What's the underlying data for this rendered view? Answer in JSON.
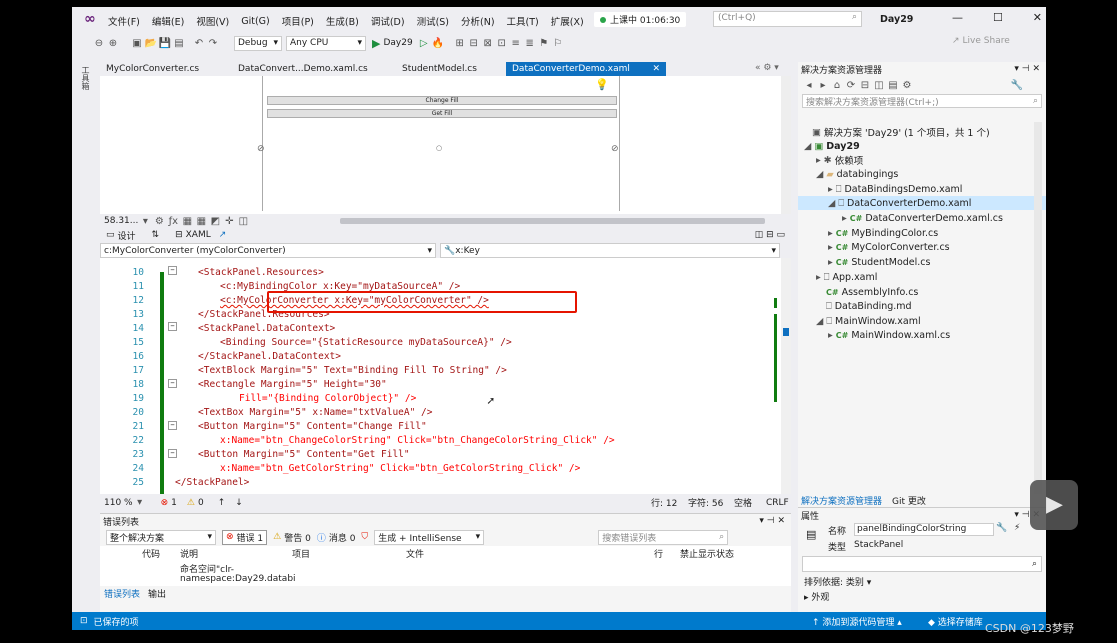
{
  "menu": [
    "文件(F)",
    "编辑(E)",
    "视图(V)",
    "Git(G)",
    "项目(P)",
    "生成(B)",
    "调试(D)",
    "测试(S)",
    "分析(N)",
    "工具(T)",
    "扩展(X)"
  ],
  "recording": "上课中 01:06:30",
  "search_placeholder": "(Ctrl+Q)",
  "solution_name": "Day29",
  "toolbar": {
    "config": "Debug",
    "platform": "Any CPU",
    "run": "Day29",
    "live_share": "Live Share"
  },
  "tabs": [
    {
      "label": "MyColorConverter.cs"
    },
    {
      "label": "DataConvert...Demo.xaml.cs"
    },
    {
      "label": "StudentModel.cs"
    },
    {
      "label": "DataConverterDemo.xaml"
    }
  ],
  "designer": {
    "buttons": [
      "Change Fill",
      "Get Fill"
    ],
    "zoom": "58.31..."
  },
  "split": {
    "design": "设计",
    "xaml": "XAML"
  },
  "navbar": {
    "left": "c:MyColorConverter (myColorConverter)",
    "right": "x:Key"
  },
  "code_lines": [
    {
      "n": "10",
      "t": "<StackPanel.Resources>"
    },
    {
      "n": "11",
      "t": "<c:MyBindingColor x:Key=\"myDataSourceA\" />"
    },
    {
      "n": "12",
      "t": "<c:MyColorConverter x:Key=\"myColorConverter\" />"
    },
    {
      "n": "13",
      "t": "</StackPanel.Resources>"
    },
    {
      "n": "14",
      "t": "<StackPanel.DataContext>"
    },
    {
      "n": "15",
      "t": "<Binding Source=\"{StaticResource myDataSourceA}\" />"
    },
    {
      "n": "16",
      "t": "</StackPanel.DataContext>"
    },
    {
      "n": "17",
      "t": "<TextBlock Margin=\"5\" Text=\"Binding Fill To String\" />"
    },
    {
      "n": "18",
      "t": "<Rectangle Margin=\"5\" Height=\"30\""
    },
    {
      "n": "19",
      "t": "Fill=\"{Binding ColorObject}\" />"
    },
    {
      "n": "20",
      "t": "<TextBox Margin=\"5\" x:Name=\"txtValueA\" />"
    },
    {
      "n": "21",
      "t": "<Button Margin=\"5\" Content=\"Change Fill\""
    },
    {
      "n": "22",
      "t": "x:Name=\"btn_ChangeColorString\" Click=\"btn_ChangeColorString_Click\" />"
    },
    {
      "n": "23",
      "t": "<Button Margin=\"5\" Content=\"Get Fill\""
    },
    {
      "n": "24",
      "t": "x:Name=\"btn_GetColorString\" Click=\"btn_GetColorString_Click\" />"
    },
    {
      "n": "25",
      "t": "</StackPanel>"
    }
  ],
  "editor_status": {
    "zoom": "110 %",
    "errors": "1",
    "warnings": "0",
    "line": "行: 12",
    "col": "字符: 56",
    "space": "空格",
    "eol": "CRLF"
  },
  "error_list": {
    "title": "错误列表",
    "scope": "整个解决方案",
    "errors": "错误 1",
    "warnings": "警告 0",
    "messages": "消息 0",
    "build": "生成 + IntelliSense",
    "search": "搜索错误列表",
    "cols": [
      "代码",
      "说明",
      "项目",
      "文件",
      "行",
      "禁止显示状态"
    ],
    "desc1": "命名空间\"clr-",
    "desc2": "namespace:Day29.databi",
    "tab_err": "错误列表",
    "tab_out": "输出"
  },
  "solution_explorer": {
    "title": "解决方案资源管理器",
    "search": "搜索解决方案资源管理器(Ctrl+;)",
    "root": "解决方案 'Day29' (1 个项目，共 1 个)",
    "items": [
      {
        "label": "Day29",
        "bold": true
      },
      {
        "label": "依赖项"
      },
      {
        "label": "databingings"
      },
      {
        "label": "DataBindingsDemo.xaml"
      },
      {
        "label": "DataConverterDemo.xaml"
      },
      {
        "label": "DataConverterDemo.xaml.cs"
      },
      {
        "label": "MyBindingColor.cs"
      },
      {
        "label": "MyColorConverter.cs"
      },
      {
        "label": "StudentModel.cs"
      },
      {
        "label": "App.xaml"
      },
      {
        "label": "AssemblyInfo.cs"
      },
      {
        "label": "DataBinding.md"
      },
      {
        "label": "MainWindow.xaml"
      },
      {
        "label": "MainWindow.xaml.cs"
      }
    ],
    "tab_sol": "解决方案资源管理器",
    "tab_git": "Git 更改"
  },
  "properties": {
    "title": "属性",
    "name_label": "名称",
    "name_value": "panelBindingColorString",
    "type_label": "类型",
    "type_value": "StackPanel",
    "sort": "排列依据: 类别",
    "group": "外观"
  },
  "statusbar": {
    "saved": "已保存的项",
    "add_source": "添加到源代码管理",
    "select_repo": "选择存储库"
  },
  "watermark": "CSDN @123梦野"
}
